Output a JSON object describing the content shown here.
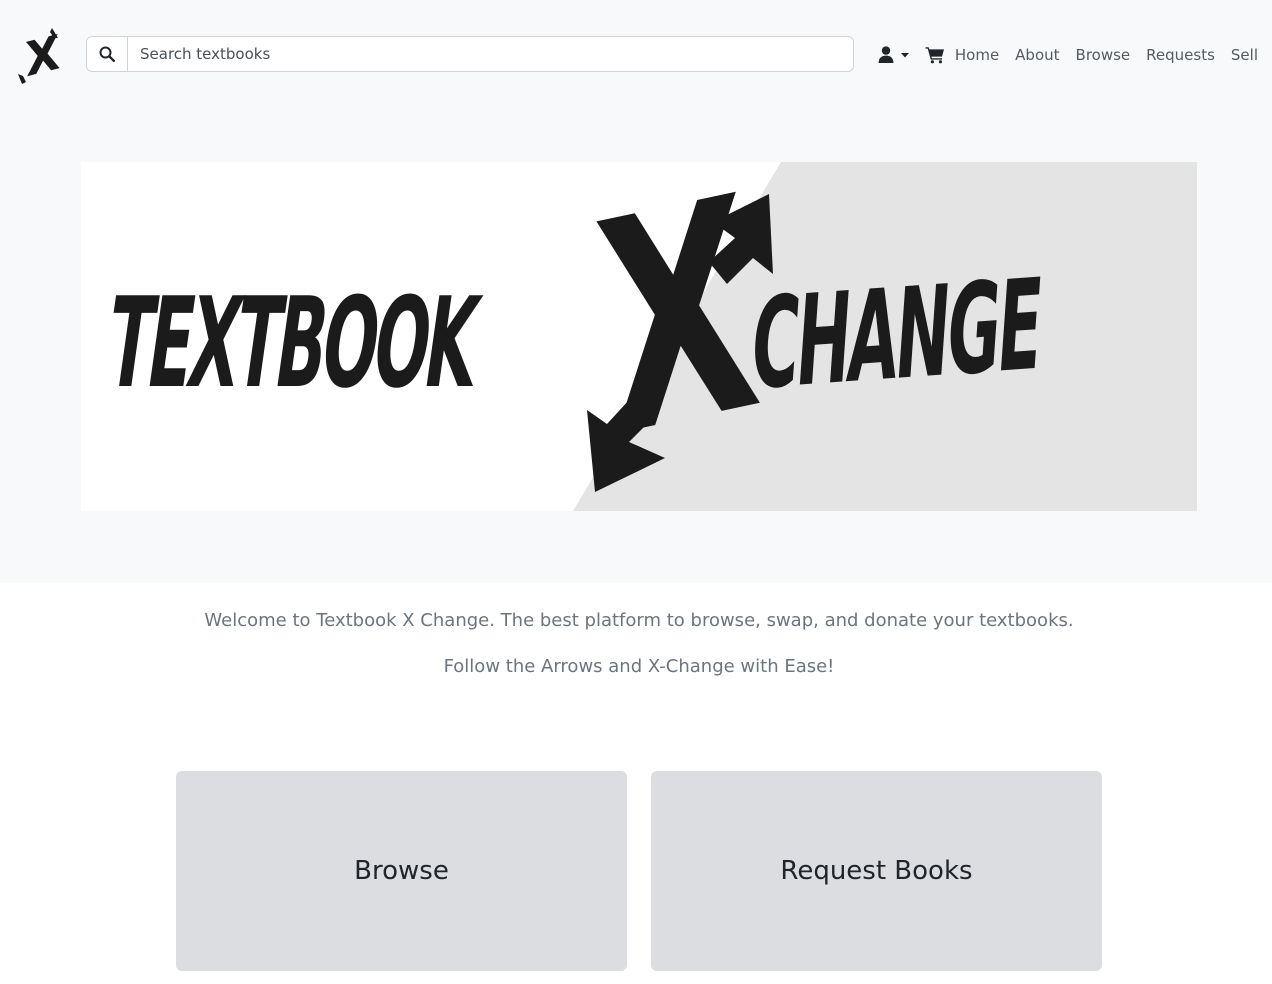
{
  "navbar": {
    "logo": {
      "icon": "x-arrow-logo-icon",
      "letter": "X"
    },
    "search": {
      "icon": "search-icon",
      "placeholder": "Search textbooks",
      "value": ""
    },
    "account_icon": "user-icon",
    "dropdown_icon": "caret-down-icon",
    "cart_icon": "cart-icon",
    "links": [
      "Home",
      "About",
      "Browse",
      "Requests",
      "Sell"
    ]
  },
  "hero": {
    "banner": {
      "word_left": "TEXTBOOK",
      "word_mid": "X",
      "word_right": "CHANGE",
      "colors": {
        "left_bg": "#ffffff",
        "right_bg": "#e4e4e4",
        "ink": "#1b1b1b"
      }
    },
    "welcome": "Welcome to Textbook X Change. The best platform to browse, swap, and donate your textbooks.",
    "tagline": "Follow the Arrows and X-Change with Ease!"
  },
  "cards": [
    {
      "title": "Browse"
    },
    {
      "title": "Request Books"
    }
  ],
  "colors": {
    "hero_band": "#f8f9fa",
    "card_bg": "#dcdde0",
    "muted_text": "#6c757d",
    "nav_text": "#555b61"
  }
}
